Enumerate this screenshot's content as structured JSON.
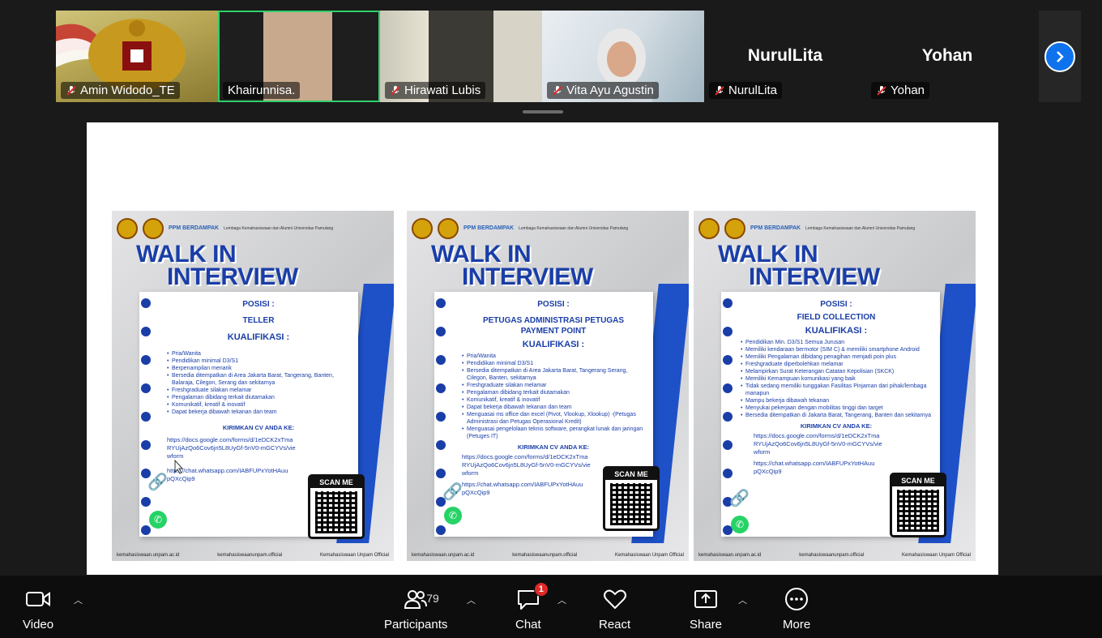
{
  "participants": [
    {
      "name": "Amin Widodo_TE",
      "muted": true,
      "video": true
    },
    {
      "name": "Khairunnisa.",
      "muted": false,
      "video": true,
      "active": true
    },
    {
      "name": "Hirawati Lubis",
      "muted": true,
      "video": true
    },
    {
      "name": "Vita Ayu Agustin",
      "muted": true,
      "video": true
    },
    {
      "name": "NurulLita",
      "muted": true,
      "video": false
    },
    {
      "name": "Yohan",
      "muted": true,
      "video": false
    }
  ],
  "share": {
    "posters": [
      {
        "logo_tag": "PPM BERDAMPAK",
        "logo_lem": "Lembaga Kemahasiswaan dan Alumni Universitas Pamulang",
        "title_1": "WALK IN",
        "title_2": "INTERVIEW",
        "posisi": "POSISI :",
        "role": "TELLER",
        "kualifikasi": "KUALIFIKASI :",
        "items": [
          "Pria/Wanita",
          "Pendidikan minimal D3/S1",
          "Berpenampilan menarik",
          "Bersedia ditempatkan di Area Jakarta Barat, Tangerang, Banten, Balaraja, Cilegon, Serang dan sekitarnya",
          "Freshgraduate silakan melamar",
          "Pengalaman dibidang terkait diutamakan",
          "Komunikatif, kreatif & inovatif",
          "Dapat bekerja dibawah tekanan dan team"
        ],
        "kirim": "KIRIMKAN CV ANDA KE:",
        "url": "https://docs.google.com/forms/d/1eDCK2xTmaRYUjAzQo6Cov6jn5L8UyGf-5nV0-mGCYVs/viewform",
        "wa": "https://chat.whatsapp.com/IABFUPxYotHAuupQXcQip9",
        "scan": "SCAN ME",
        "footer_web": "kemahasiswaan.unpam.ac.id",
        "footer_ig": "kemahasiswaanunpam.official",
        "footer_yt": "Kemahasiswaan Unpam Official"
      },
      {
        "logo_tag": "PPM BERDAMPAK",
        "logo_lem": "Lembaga Kemahasiswaan dan Alumni Universitas Pamulang",
        "title_1": "WALK IN",
        "title_2": "INTERVIEW",
        "posisi": "POSISI :",
        "role": "PETUGAS ADMINISTRASI PETUGAS PAYMENT POINT",
        "kualifikasi": "KUALIFIKASI :",
        "items": [
          "Pria/Wanita",
          "Pendidikan minimal D3/S1",
          "Bersedia ditempatkan di Area Jakarta Barat, Tangerang Serang, Cilegon, Banten, sekitarnya",
          "Freshgraduate silakan melamar",
          "Pengalaman dibidang terkait diutamakan",
          "Komunikatif, kreatif & inovatif",
          "Dapat bekerja dibawah tekanan dan team",
          "Menguasai ms office dan excel (Pivot, Vlookup, Xlookup) -(Petugas Administrasi dan Petugas Operasional Kredit)",
          "Menguasai pengelolaan teknis software, perangkat lunak dan jaringan (Petuges IT)"
        ],
        "kirim": "KIRIMKAN CV ANDA KE:",
        "url": "https://docs.google.com/forms/d/1eDCK2xTmaRYUjAzQo6Cov6jn5L8UyGf-5nV0-mGCYVs/viewform",
        "wa": "https://chat.whatsapp.com/IABFUPxYotHAuupQXcQip9",
        "scan": "SCAN ME",
        "footer_web": "kemahasiswaan.unpam.ac.id",
        "footer_ig": "kemahasiswaanunpam.official",
        "footer_yt": "Kemahasiswaan Unpam Official"
      },
      {
        "logo_tag": "PPM BERDAMPAK",
        "logo_lem": "Lembaga Kemahasiswaan dan Alumni Universitas Pamulang",
        "title_1": "WALK IN",
        "title_2": "INTERVIEW",
        "posisi": "POSISI :",
        "role": "FIELD COLLECTION",
        "kualifikasi": "KUALIFIKASI :",
        "items": [
          "Pendidikan Min. D3/S1 Semua Jurusan",
          "Memiliki kendaraan bermotor (SIM C) & memiliki smartphone Android",
          "Memiliki Pengalaman dibidang penagihan menjadi poin plus",
          "Freshgraduate diperbolehkan melamar",
          "Melampirkan Surat Keterangan Catatan Kepolisian (SKCK)",
          "Memiliki Kemampuan komunikasi yang baik",
          "Tidak sedang memiliki tunggakan Fasilitas Pinjaman dari pihak/lembaga manapun",
          "Mampu bekerja dibawah tekanan",
          "Menyukai pekerjaan dengan mobilitas tinggi dan target",
          "Bersedia ditempatkan di Jakarta Barat, Tangerang, Banten dan sekitarnya"
        ],
        "kirim": "KIRIMKAN CV ANDA KE:",
        "url": "https://docs.google.com/forms/d/1eDCK2xTmaRYUjAzQo6Cov6jn5L8UyGf-5nV0-mGCYVs/viewform",
        "wa": "https://chat.whatsapp.com/IABFUPxYotHAuupQXcQip9",
        "scan": "SCAN ME",
        "footer_web": "kemahasiswaan.unpam.ac.id",
        "footer_ig": "kemahasiswaanunpam.official",
        "footer_yt": "Kemahasiswaan Unpam Official"
      }
    ]
  },
  "toolbar": {
    "video_label": "Video",
    "participants_label": "Participants",
    "participants_count": "79",
    "chat_label": "Chat",
    "chat_badge": "1",
    "react_label": "React",
    "share_label": "Share",
    "more_label": "More"
  }
}
